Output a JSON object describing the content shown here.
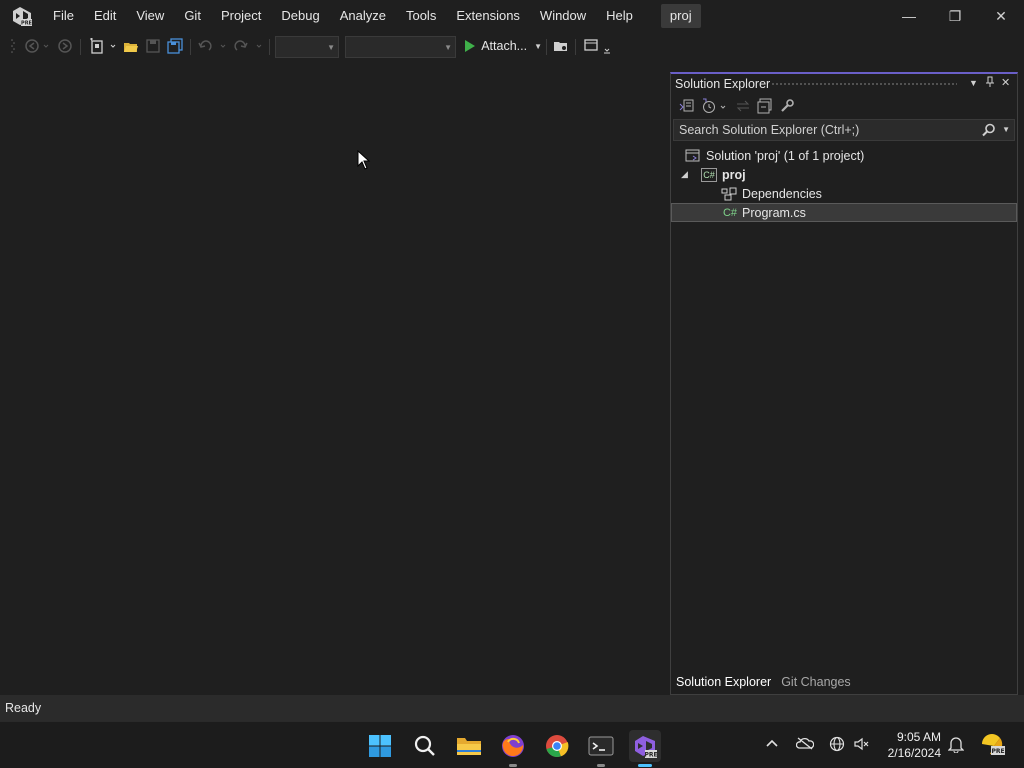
{
  "window": {
    "menu": [
      "File",
      "Edit",
      "View",
      "Git",
      "Project",
      "Debug",
      "Analyze",
      "Tools",
      "Extensions",
      "Window",
      "Help"
    ],
    "project_badge": "proj",
    "controls": {
      "minimize": "—",
      "restore": "❐",
      "close": "✕"
    },
    "accent_color": "#6a5fc8"
  },
  "toolbar": {
    "attach_label": "Attach...",
    "config_dropdown_value": "",
    "platform_dropdown_value": "",
    "run_color": "#3fb04a"
  },
  "solution_explorer": {
    "title": "Solution Explorer",
    "search_placeholder": "Search Solution Explorer (Ctrl+;)",
    "tree": {
      "solution": "Solution 'proj' (1 of 1 project)",
      "project": "proj",
      "dependencies": "Dependencies",
      "file": "Program.cs",
      "file_icon": "C#",
      "project_icon": "C#"
    },
    "tabs": {
      "active": "Solution Explorer",
      "other": "Git Changes"
    }
  },
  "status": {
    "text": "Ready"
  },
  "taskbar": {
    "time": "9:05 AM",
    "date": "2/16/2024"
  }
}
